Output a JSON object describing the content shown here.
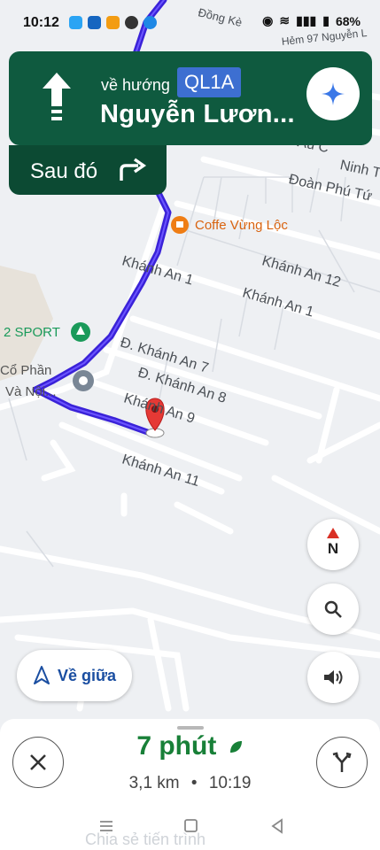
{
  "status_bar": {
    "time": "10:12",
    "battery": "68%",
    "top_road_a": "Đồng Kè",
    "top_road_b": "Hẻm 97 Nguyễn L"
  },
  "navigation": {
    "toward_label": "về hướng",
    "road_badge": "QL1A",
    "street_name": "Nguyễn Lươn...",
    "then_label": "Sau đó",
    "maneuver_icon": "arrow-straight-up",
    "next_maneuver_icon": "turn-right-arrow",
    "header_color": "#0f5a3f",
    "badge_color": "#3d6fd1"
  },
  "map": {
    "route_color": "#3a22d8",
    "street_labels": {
      "khanh_an_1a": "Khánh An 1",
      "khanh_an_12": "Khánh An 12",
      "khanh_an_1b": "Khánh An 1",
      "khanh_an_7": "Đ. Khánh An 7",
      "khanh_an_8": "Đ. Khánh An 8",
      "khanh_an_9": "Khánh An 9",
      "khanh_an_11": "Khánh An 11",
      "ninh_t": "Ninh T",
      "doan_phu_tu": "Đoàn Phú Tứ",
      "au_co": "Âu C"
    },
    "pois": {
      "cafe": "Coffe Vừng Lộc",
      "sport": "2 SPORT",
      "company_line1": "Cổ Phần",
      "company_line2": "Và Nội..."
    }
  },
  "controls": {
    "compass_label": "N",
    "recenter_label": "Về giữa"
  },
  "trip": {
    "duration": "7 phút",
    "distance": "3,1 km",
    "arrival": "10:19",
    "separator": "•",
    "eta_color": "#188038"
  },
  "system_nav": {
    "ghost_text": "Chia sẻ tiến trình"
  }
}
